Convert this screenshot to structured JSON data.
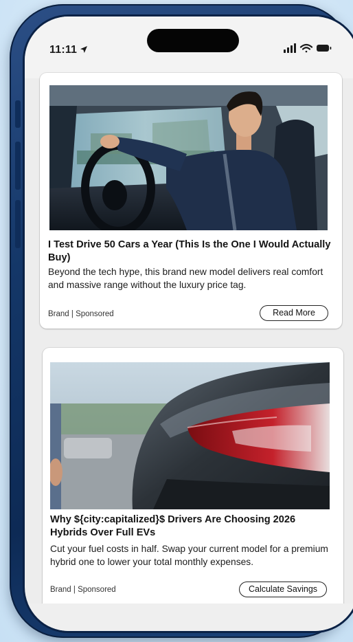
{
  "status_bar": {
    "time": "11:11",
    "icons": [
      "location-arrow-icon",
      "signal-icon",
      "wifi-icon",
      "battery-icon"
    ]
  },
  "ads": [
    {
      "image": "man-driving-car-photo",
      "headline": "I Test Drive 50 Cars a Year (This Is the One I Would Actually Buy)",
      "description": "Beyond the tech hype, this brand new model delivers real comfort and massive range without the luxury price tag.",
      "brand_label": "Brand | Sponsored",
      "cta_label": "Read More"
    },
    {
      "image": "car-taillight-photo",
      "headline": "Why ${city:capitalized}$ Drivers Are Choosing 2026 Hybrids Over Full EVs",
      "description": "Cut your fuel costs in half. Swap your current model for a premium hybrid one to lower your total monthly expenses.",
      "brand_label": "Brand | Sponsored",
      "cta_label": "Calculate Savings"
    }
  ],
  "colors": {
    "background": "#dcecf9",
    "phone_frame": "#143768",
    "screen": "#ededed",
    "card": "#ffffff"
  }
}
